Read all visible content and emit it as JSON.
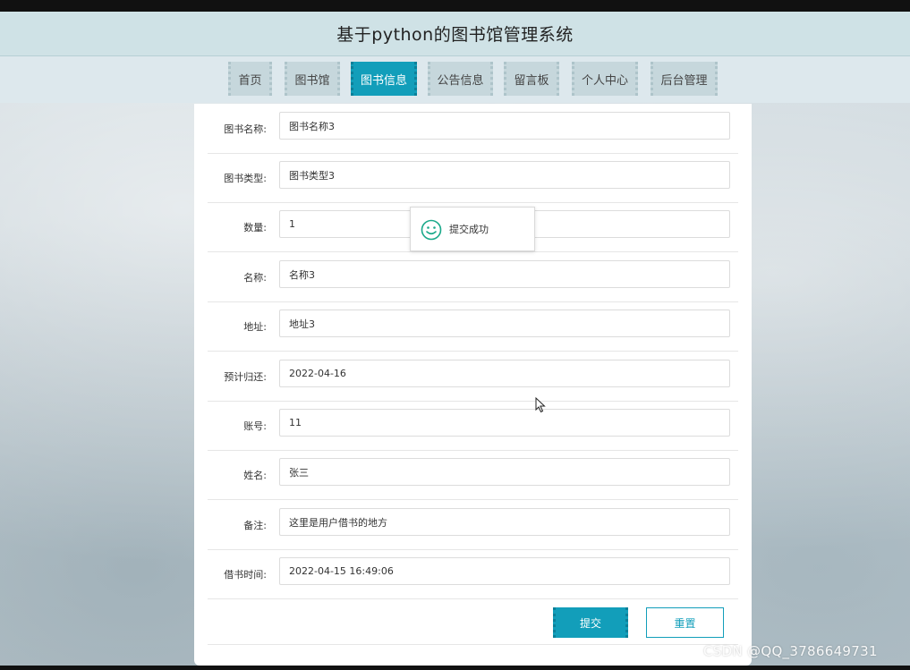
{
  "header": {
    "title": "基于python的图书馆管理系统"
  },
  "nav": {
    "items": [
      {
        "label": "首页",
        "active": false
      },
      {
        "label": "图书馆",
        "active": false
      },
      {
        "label": "图书信息",
        "active": true
      },
      {
        "label": "公告信息",
        "active": false
      },
      {
        "label": "留言板",
        "active": false
      },
      {
        "label": "个人中心",
        "active": false
      },
      {
        "label": "后台管理",
        "active": false
      }
    ]
  },
  "form": {
    "fields": [
      {
        "label": "图书名称:",
        "value": "图书名称3"
      },
      {
        "label": "图书类型:",
        "value": "图书类型3"
      },
      {
        "label": "数量:",
        "value": "1"
      },
      {
        "label": "名称:",
        "value": "名称3"
      },
      {
        "label": "地址:",
        "value": "地址3"
      },
      {
        "label": "预计归还:",
        "value": "2022-04-16"
      },
      {
        "label": "账号:",
        "value": "11"
      },
      {
        "label": "姓名:",
        "value": "张三"
      },
      {
        "label": "备注:",
        "value": "这里是用户借书的地方"
      },
      {
        "label": "借书时间:",
        "value": "2022-04-15 16:49:06"
      }
    ],
    "submit_label": "提交",
    "reset_label": "重置"
  },
  "toast": {
    "icon": "smile-icon",
    "text": "提交成功"
  },
  "watermark": "CSDN @QQ_3786649731",
  "colors": {
    "accent": "#129eba",
    "header_bg": "#cfe2e6",
    "nav_bg": "#c6d7dc"
  }
}
